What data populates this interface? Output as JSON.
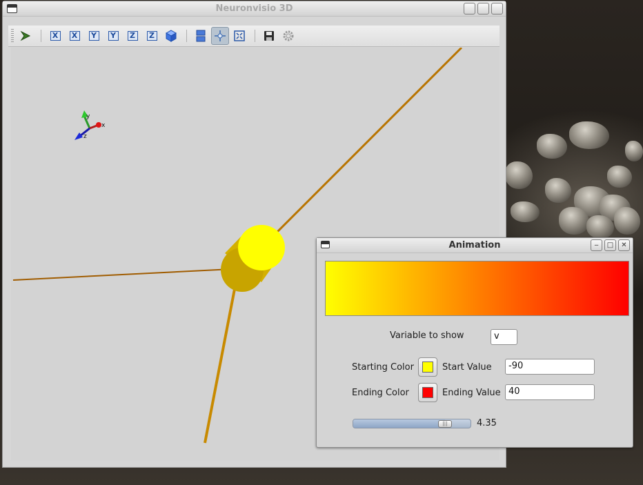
{
  "main_window": {
    "title": "Neuronvisio 3D",
    "toolbar": {
      "axis_buttons": [
        "X",
        "X",
        "Y",
        "Y",
        "Z",
        "Z"
      ]
    }
  },
  "scene": {
    "orientation_axes": {
      "x": "x",
      "y": "y",
      "z": "z"
    },
    "soma_color": "#ffff00",
    "dendrite_colors": [
      "#d8a200",
      "#a86400"
    ]
  },
  "animation_dialog": {
    "title": "Animation",
    "gradient": {
      "start_color": "#ffff00",
      "end_color": "#ff0000"
    },
    "variable_label": "Variable to show",
    "variable_value": "v",
    "starting_color_label": "Starting Color",
    "starting_color": "#ffff00",
    "start_value_label": "Start Value",
    "start_value": "-90",
    "ending_color_label": "Ending Color",
    "ending_color": "#ff0000",
    "end_value_label": "Ending Value",
    "end_value": "40",
    "time_slider": {
      "value": 4.35,
      "fraction": 0.82
    },
    "time_readout": "4.35"
  }
}
